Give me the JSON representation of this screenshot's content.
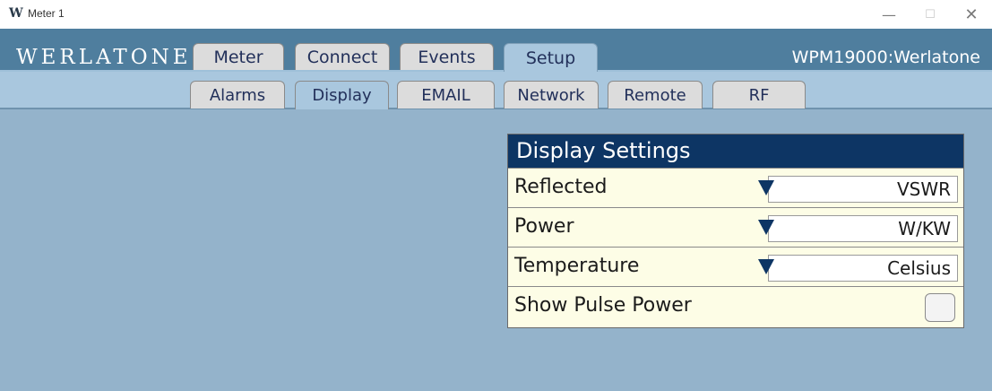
{
  "window": {
    "title": "Meter 1",
    "app_icon_glyph": "W",
    "app_icon": "werlatone-w-icon",
    "controls": {
      "minimize": "—",
      "maximize": "☐",
      "close": "✕"
    }
  },
  "header": {
    "brand": "WERLATONE",
    "device": "WPM19000:Werlatone",
    "tabs": [
      {
        "label": "Meter",
        "active": false
      },
      {
        "label": "Connect",
        "active": false
      },
      {
        "label": "Events",
        "active": false
      },
      {
        "label": "Setup",
        "active": true
      }
    ]
  },
  "subtabs": [
    {
      "label": "Alarms",
      "active": false
    },
    {
      "label": "Display",
      "active": true
    },
    {
      "label": "EMAIL",
      "active": false
    },
    {
      "label": "Network",
      "active": false
    },
    {
      "label": "Remote",
      "active": false
    },
    {
      "label": "RF",
      "active": false
    }
  ],
  "display_settings": {
    "title": "Display Settings",
    "rows": [
      {
        "label": "Reflected",
        "value": "VSWR"
      },
      {
        "label": "Power",
        "value": "W/KW"
      },
      {
        "label": "Temperature",
        "value": "Celsius"
      }
    ],
    "pulse_power": {
      "label": "Show Pulse Power",
      "checked": false
    }
  },
  "colors": {
    "header_bg": "#4f7e9e",
    "subbar_bg": "#a9c7de",
    "content_bg": "#94b3cb",
    "panel_header_bg": "#0d3564",
    "panel_bg": "#fdfde6"
  }
}
